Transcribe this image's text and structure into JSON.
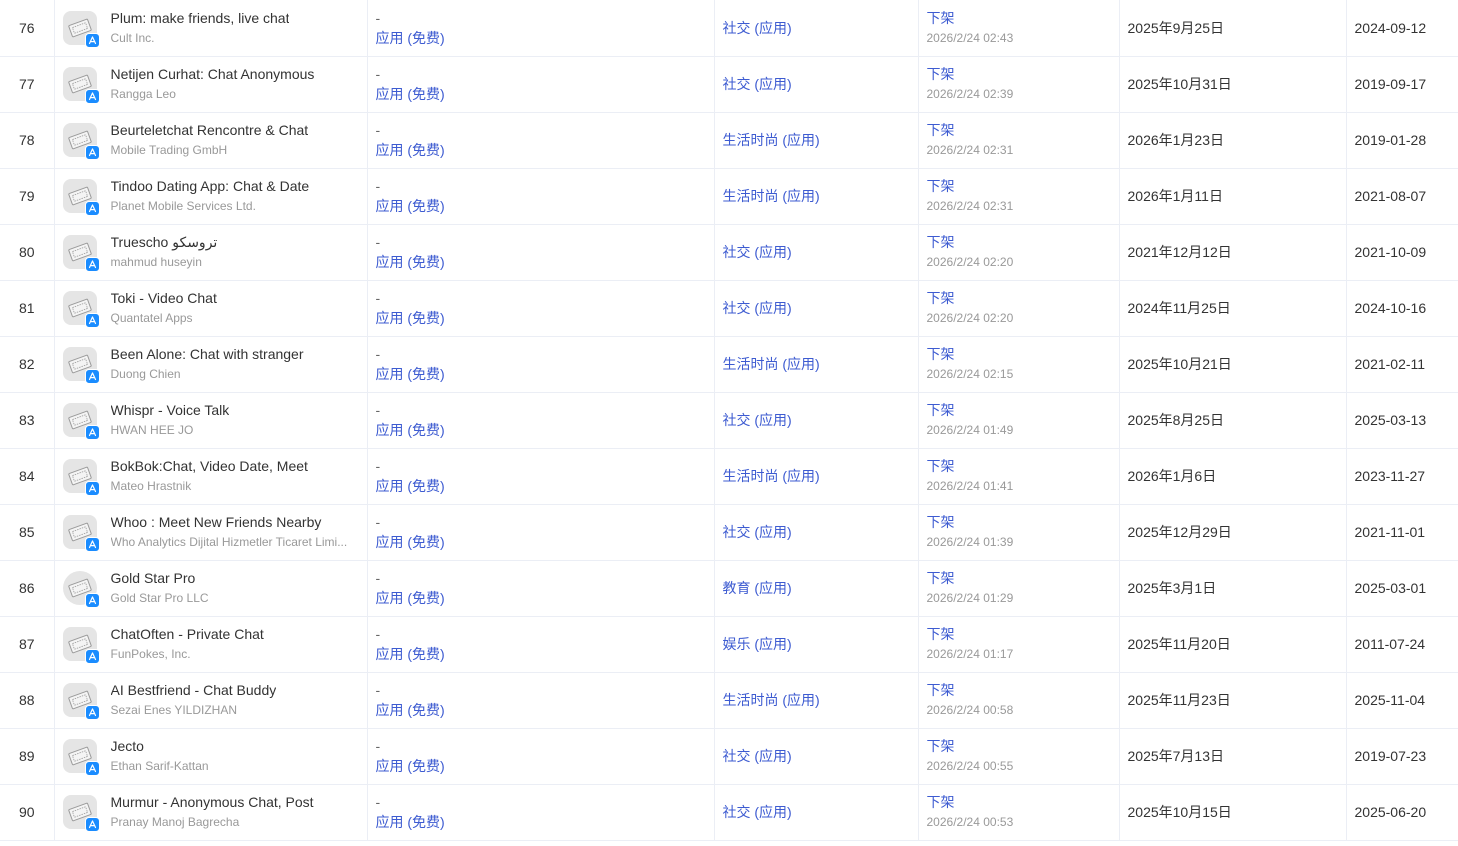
{
  "rows": [
    {
      "rank": "76",
      "name": "Plum: make friends, live chat",
      "developer": "Cult Inc.",
      "price_dash": "-",
      "price": "应用 (免费)",
      "category": "社交 (应用)",
      "status": "下架",
      "status_time": "2026/2/24 02:43",
      "updated": "2025年9月25日",
      "released": "2024-09-12"
    },
    {
      "rank": "77",
      "name": "Netijen Curhat: Chat Anonymous",
      "developer": "Rangga Leo",
      "price_dash": "-",
      "price": "应用 (免费)",
      "category": "社交 (应用)",
      "status": "下架",
      "status_time": "2026/2/24 02:39",
      "updated": "2025年10月31日",
      "released": "2019-09-17"
    },
    {
      "rank": "78",
      "name": "Beurteletchat Rencontre & Chat",
      "developer": "Mobile Trading GmbH",
      "price_dash": "-",
      "price": "应用 (免费)",
      "category": "生活时尚 (应用)",
      "status": "下架",
      "status_time": "2026/2/24 02:31",
      "updated": "2026年1月23日",
      "released": "2019-01-28"
    },
    {
      "rank": "79",
      "name": "Tindoo Dating App: Chat & Date",
      "developer": "Planet Mobile Services Ltd.",
      "price_dash": "-",
      "price": "应用 (免费)",
      "category": "生活时尚 (应用)",
      "status": "下架",
      "status_time": "2026/2/24 02:31",
      "updated": "2026年1月11日",
      "released": "2021-08-07"
    },
    {
      "rank": "80",
      "name": "Truescho تروسكو",
      "developer": "mahmud huseyin",
      "price_dash": "-",
      "price": "应用 (免费)",
      "category": "社交 (应用)",
      "status": "下架",
      "status_time": "2026/2/24 02:20",
      "updated": "2021年12月12日",
      "released": "2021-10-09"
    },
    {
      "rank": "81",
      "name": "Toki - Video Chat",
      "developer": "Quantatel Apps",
      "price_dash": "-",
      "price": "应用 (免费)",
      "category": "社交 (应用)",
      "status": "下架",
      "status_time": "2026/2/24 02:20",
      "updated": "2024年11月25日",
      "released": "2024-10-16"
    },
    {
      "rank": "82",
      "name": "Been Alone: Chat with stranger",
      "developer": "Duong Chien",
      "price_dash": "-",
      "price": "应用 (免费)",
      "category": "生活时尚 (应用)",
      "status": "下架",
      "status_time": "2026/2/24 02:15",
      "updated": "2025年10月21日",
      "released": "2021-02-11"
    },
    {
      "rank": "83",
      "name": "Whispr - Voice Talk",
      "developer": "HWAN HEE JO",
      "price_dash": "-",
      "price": "应用 (免费)",
      "category": "社交 (应用)",
      "status": "下架",
      "status_time": "2026/2/24 01:49",
      "updated": "2025年8月25日",
      "released": "2025-03-13"
    },
    {
      "rank": "84",
      "name": "BokBok:Chat, Video Date, Meet",
      "developer": "Mateo Hrastnik",
      "price_dash": "-",
      "price": "应用 (免费)",
      "category": "生活时尚 (应用)",
      "status": "下架",
      "status_time": "2026/2/24 01:41",
      "updated": "2026年1月6日",
      "released": "2023-11-27"
    },
    {
      "rank": "85",
      "name": "Whoo : Meet New Friends Nearby",
      "developer": "Who Analytics Dijital Hizmetler Ticaret Limi...",
      "price_dash": "-",
      "price": "应用 (免费)",
      "category": "社交 (应用)",
      "status": "下架",
      "status_time": "2026/2/24 01:39",
      "updated": "2025年12月29日",
      "released": "2021-11-01"
    },
    {
      "rank": "86",
      "name": "Gold Star Pro",
      "developer": "Gold Star Pro LLC",
      "price_dash": "-",
      "price": "应用 (免费)",
      "category": "教育 (应用)",
      "status": "下架",
      "status_time": "2026/2/24 01:29",
      "updated": "2025年3月1日",
      "released": "2025-03-01"
    },
    {
      "rank": "87",
      "name": "ChatOften - Private Chat",
      "developer": "FunPokes, Inc.",
      "price_dash": "-",
      "price": "应用 (免费)",
      "category": "娱乐 (应用)",
      "status": "下架",
      "status_time": "2026/2/24 01:17",
      "updated": "2025年11月20日",
      "released": "2011-07-24"
    },
    {
      "rank": "88",
      "name": "AI Bestfriend - Chat Buddy",
      "developer": "Sezai Enes YILDIZHAN",
      "price_dash": "-",
      "price": "应用 (免费)",
      "category": "生活时尚 (应用)",
      "status": "下架",
      "status_time": "2026/2/24 00:58",
      "updated": "2025年11月23日",
      "released": "2025-11-04"
    },
    {
      "rank": "89",
      "name": "Jecto",
      "developer": "Ethan Sarif-Kattan",
      "price_dash": "-",
      "price": "应用 (免费)",
      "category": "社交 (应用)",
      "status": "下架",
      "status_time": "2026/2/24 00:55",
      "updated": "2025年7月13日",
      "released": "2019-07-23"
    },
    {
      "rank": "90",
      "name": "Murmur - Anonymous Chat, Post",
      "developer": "Pranay Manoj Bagrecha",
      "price_dash": "-",
      "price": "应用 (免费)",
      "category": "社交 (应用)",
      "status": "下架",
      "status_time": "2026/2/24 00:53",
      "updated": "2025年10月15日",
      "released": "2025-06-20"
    }
  ],
  "icons": {
    "app_icon": "app-placeholder-icon",
    "store_badge": "app-store-badge-icon"
  },
  "colors": {
    "link": "#3d5bd1",
    "badge": "#1a8cff",
    "border": "#ebeef5"
  }
}
